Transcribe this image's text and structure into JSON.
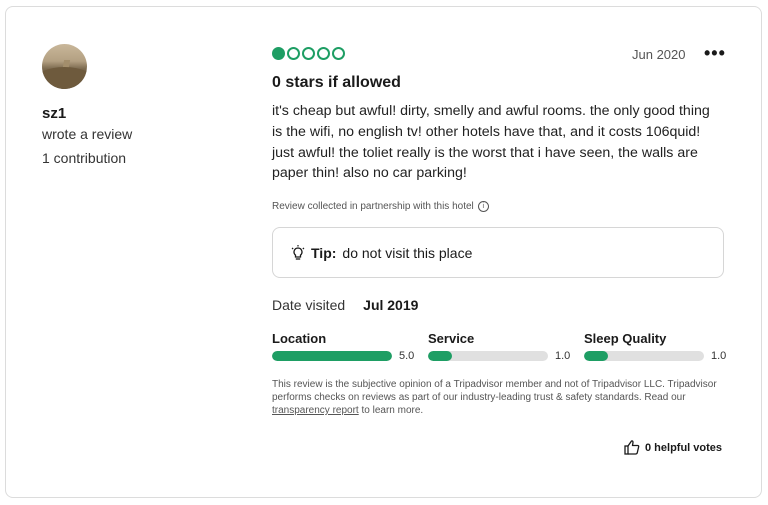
{
  "reviewer": {
    "name": "sz1",
    "action": "wrote a review",
    "contributions": "1 contribution"
  },
  "review": {
    "rating": {
      "filled": 1,
      "total": 5,
      "color": "#1e9e64"
    },
    "date": "Jun 2020",
    "title": "0 stars if allowed",
    "text": "it's cheap but awful! dirty, smelly and awful rooms. the only good thing is the wifi, no english tv! other hotels have that, and it costs 106quid! just awful! the toliet really is the worst that i have seen, the walls are paper thin! also no car parking!",
    "partner_note": "Review collected in partnership with this hotel",
    "tip_label": "Tip:",
    "tip_text": "do not visit this place",
    "date_visited_label": "Date visited",
    "date_visited_value": "Jul 2019",
    "subratings": [
      {
        "label": "Location",
        "value": "5.0",
        "fraction": 1.0
      },
      {
        "label": "Service",
        "value": "1.0",
        "fraction": 0.2
      },
      {
        "label": "Sleep Quality",
        "value": "1.0",
        "fraction": 0.2
      }
    ],
    "disclaimer_pre": "This review is the subjective opinion of a Tripadvisor member and not of Tripadvisor LLC. Tripadvisor performs checks on reviews as part of our industry-leading trust & safety standards. Read our ",
    "disclaimer_link": "transparency report",
    "disclaimer_post": " to learn more.",
    "helpful_votes": "0 helpful votes"
  },
  "icons": {
    "more": "more-dots-icon",
    "info": "info-icon",
    "tip": "lightbulb-icon",
    "helpful": "thumbs-up-icon"
  }
}
